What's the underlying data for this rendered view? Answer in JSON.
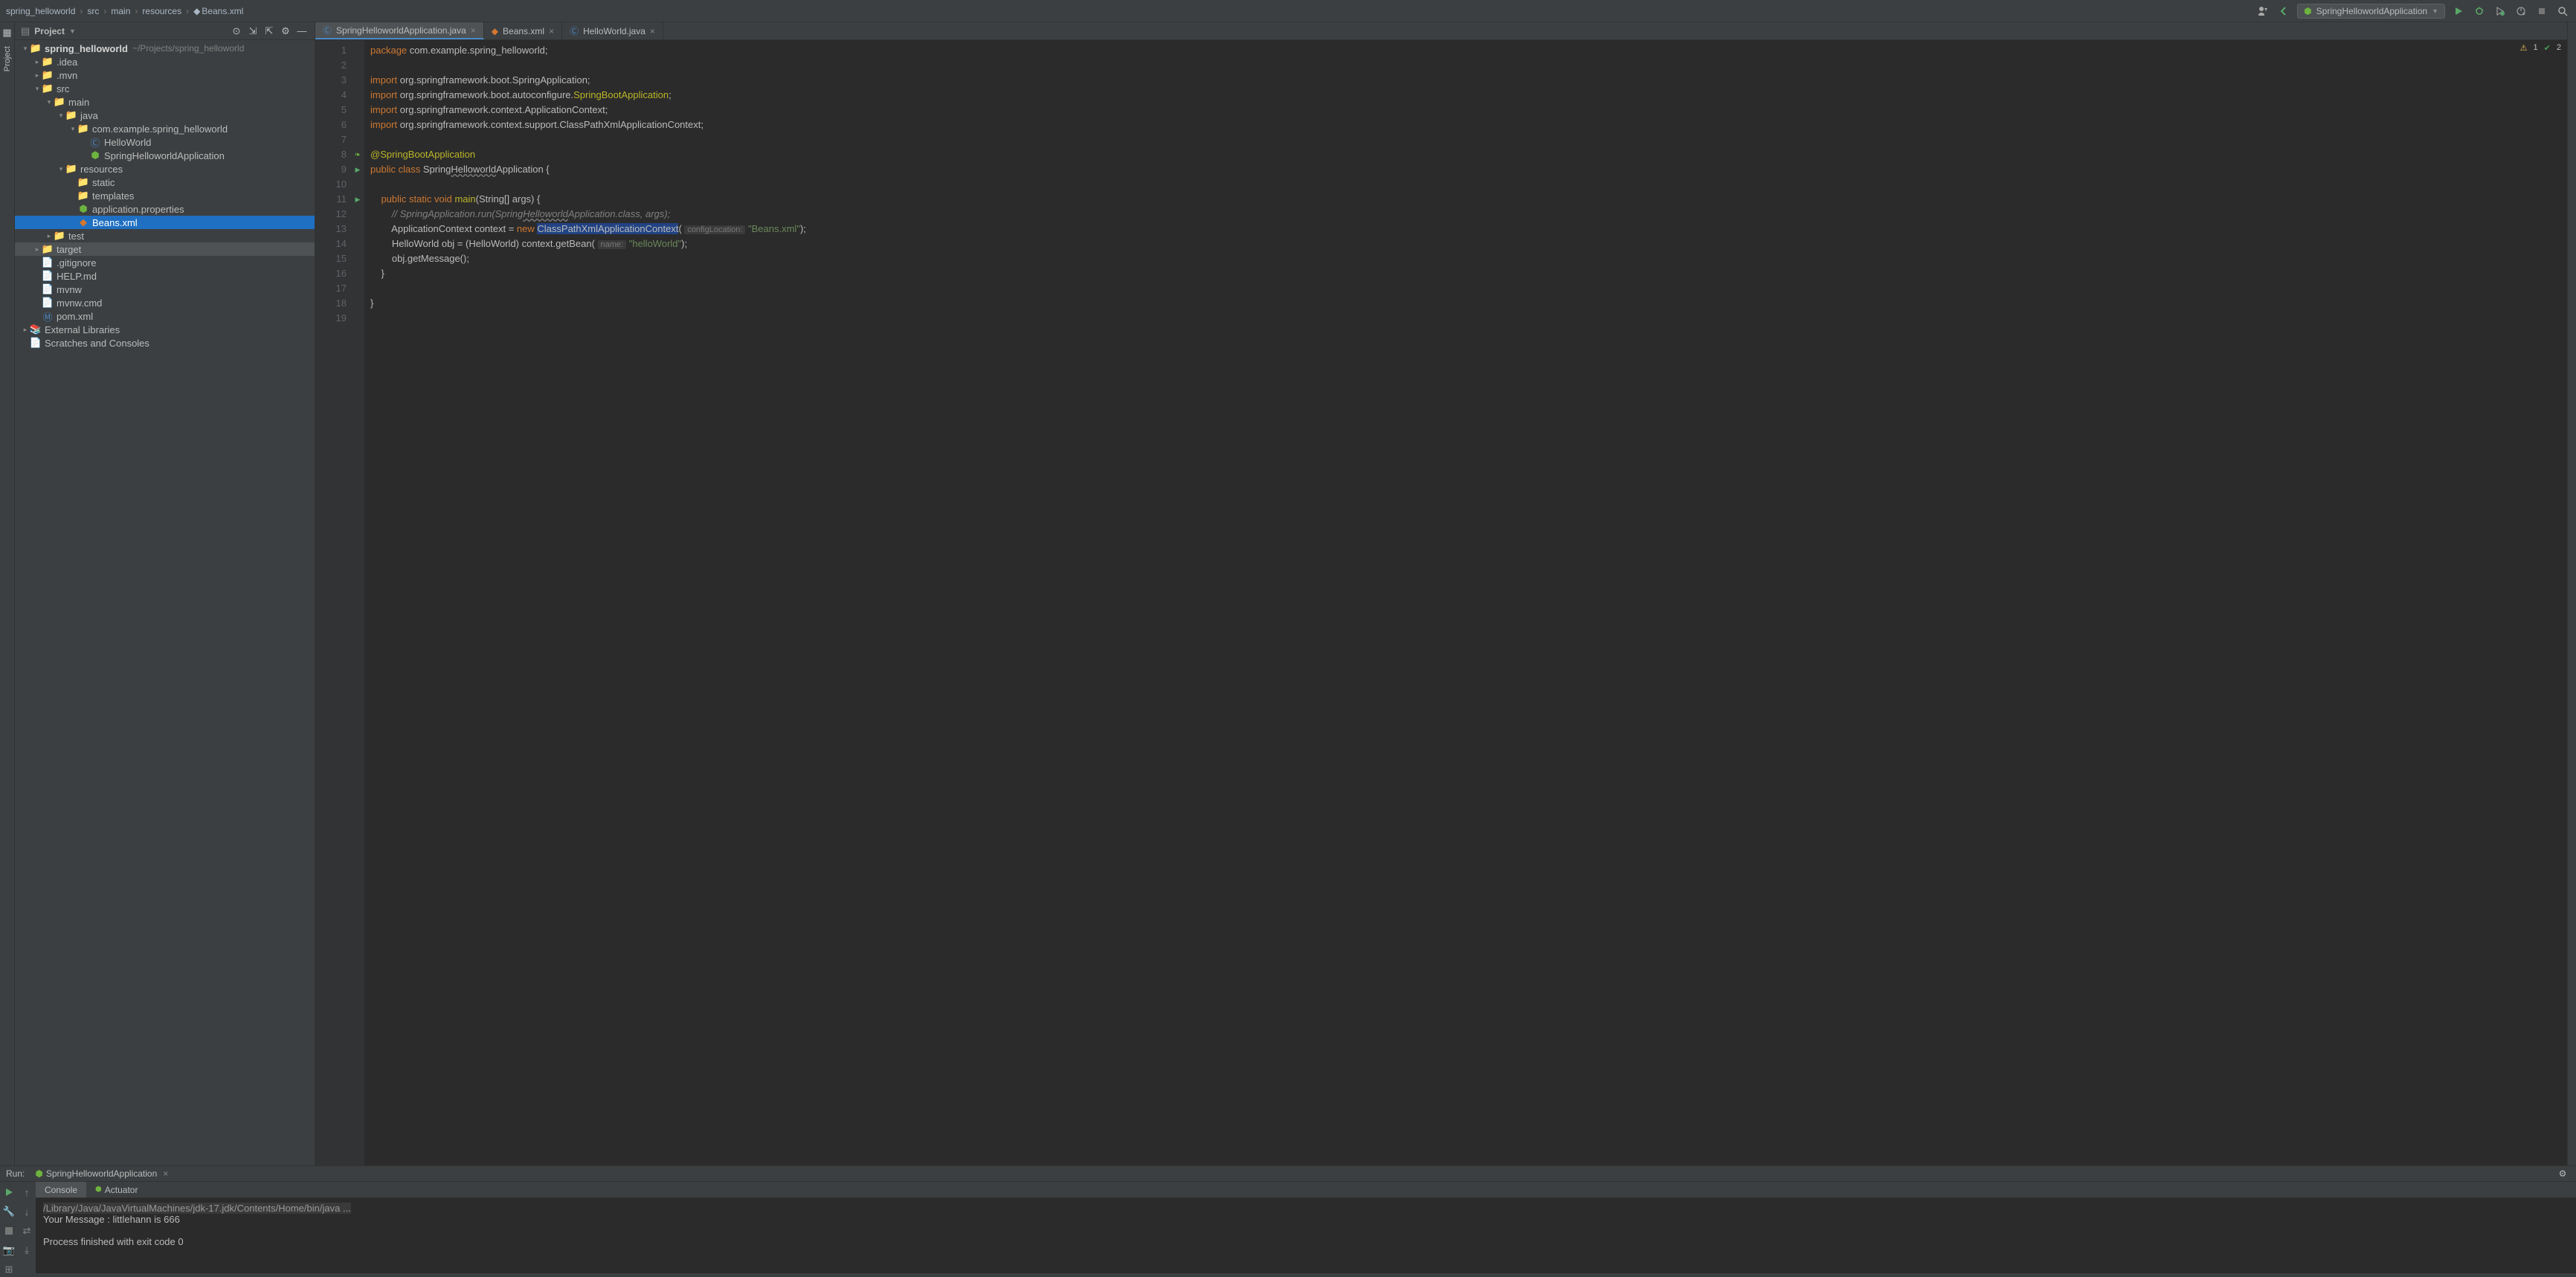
{
  "breadcrumb": [
    "spring_helloworld",
    "src",
    "main",
    "resources",
    "Beans.xml"
  ],
  "run_config_label": "SpringHelloworldApplication",
  "project_panel": {
    "title": "Project",
    "tree": [
      {
        "indent": 0,
        "arrow": "down",
        "icon": "bluefolder",
        "label": "spring_helloworld",
        "path": "~/Projects/spring_helloworld",
        "bold": true
      },
      {
        "indent": 1,
        "arrow": "right",
        "icon": "folder",
        "label": ".idea"
      },
      {
        "indent": 1,
        "arrow": "right",
        "icon": "folder",
        "label": ".mvn"
      },
      {
        "indent": 1,
        "arrow": "down",
        "icon": "bluefolder",
        "label": "src"
      },
      {
        "indent": 2,
        "arrow": "down",
        "icon": "folder",
        "label": "main"
      },
      {
        "indent": 3,
        "arrow": "down",
        "icon": "bluefolder",
        "label": "java"
      },
      {
        "indent": 4,
        "arrow": "down",
        "icon": "folder",
        "label": "com.example.spring_helloworld"
      },
      {
        "indent": 5,
        "arrow": "",
        "icon": "class",
        "label": "HelloWorld"
      },
      {
        "indent": 5,
        "arrow": "",
        "icon": "spring",
        "label": "SpringHelloworldApplication"
      },
      {
        "indent": 3,
        "arrow": "down",
        "icon": "orange",
        "label": "resources"
      },
      {
        "indent": 4,
        "arrow": "",
        "icon": "folder",
        "label": "static"
      },
      {
        "indent": 4,
        "arrow": "",
        "icon": "folder",
        "label": "templates"
      },
      {
        "indent": 4,
        "arrow": "",
        "icon": "spring",
        "label": "application.properties"
      },
      {
        "indent": 4,
        "arrow": "",
        "icon": "xml",
        "label": "Beans.xml",
        "selected": true
      },
      {
        "indent": 2,
        "arrow": "right",
        "icon": "folder",
        "label": "test"
      },
      {
        "indent": 1,
        "arrow": "right",
        "icon": "orange",
        "label": "target",
        "highlight": true
      },
      {
        "indent": 1,
        "arrow": "",
        "icon": "file",
        "label": ".gitignore"
      },
      {
        "indent": 1,
        "arrow": "",
        "icon": "file",
        "label": "HELP.md"
      },
      {
        "indent": 1,
        "arrow": "",
        "icon": "file",
        "label": "mvnw"
      },
      {
        "indent": 1,
        "arrow": "",
        "icon": "file",
        "label": "mvnw.cmd"
      },
      {
        "indent": 1,
        "arrow": "",
        "icon": "m",
        "label": "pom.xml"
      },
      {
        "indent": 0,
        "arrow": "right",
        "icon": "lib",
        "label": "External Libraries"
      },
      {
        "indent": 0,
        "arrow": "",
        "icon": "file",
        "label": "Scratches and Consoles"
      }
    ]
  },
  "editor_tabs": [
    {
      "icon": "class",
      "label": "SpringHelloworldApplication.java",
      "active": true
    },
    {
      "icon": "xml",
      "label": "Beans.xml"
    },
    {
      "icon": "class",
      "label": "HelloWorld.java"
    }
  ],
  "inspection": {
    "warnings": "1",
    "checks": "2"
  },
  "code_lines": [
    "1",
    "2",
    "3",
    "4",
    "5",
    "6",
    "7",
    "8",
    "9",
    "10",
    "11",
    "12",
    "13",
    "14",
    "15",
    "16",
    "17",
    "18",
    "19"
  ],
  "code": {
    "l1a": "package",
    "l1b": " com.example.spring_helloworld;",
    "l3a": "import",
    "l3b": " org.springframework.boot.SpringApplication;",
    "l4a": "import",
    "l4b": " org.springframework.boot.autoconfigure.",
    "l4c": "SpringBootApplication",
    "l4d": ";",
    "l5a": "import",
    "l5b": " org.springframework.context.ApplicationContext;",
    "l6a": "import",
    "l6b": " org.springframework.context.support.ClassPathXmlApplicationContext;",
    "l8a": "@SpringBootApplication",
    "l9a": "public class ",
    "l9b": "Spring",
    "l9c": "Helloworld",
    "l9d": "Application {",
    "l11a": "    public static void ",
    "l11b": "main",
    "l11c": "(String[] args) {",
    "l12a": "        // SpringApplication.run(Spring",
    "l12b": "Helloworld",
    "l12c": "Application.class, args);",
    "l13a": "        ApplicationContext context = ",
    "l13b": "new ",
    "l13c": "ClassPathXmlApplicationContext",
    "l13d": "( ",
    "l13hint": "configLocation:",
    "l13e": " ",
    "l13f": "\"Beans.xml\"",
    "l13g": ");",
    "l14a": "        HelloWorld obj = (HelloWorld) context.getBean( ",
    "l14hint": "name:",
    "l14b": " ",
    "l14c": "\"helloWorld\"",
    "l14d": ");",
    "l15a": "        obj.getMessage();",
    "l16a": "    }",
    "l18a": "}"
  },
  "run": {
    "label": "Run:",
    "tab": "SpringHelloworldApplication",
    "subtabs": [
      "Console",
      "Actuator"
    ],
    "lines": [
      {
        "text": "/Library/Java/JavaVirtualMachines/jdk-17.jdk/Contents/Home/bin/java ...",
        "dim": true
      },
      {
        "text": "Your Message : littlehann is 666"
      },
      {
        "text": ""
      },
      {
        "text": "Process finished with exit code 0"
      }
    ]
  },
  "left_rail_label": "Project"
}
